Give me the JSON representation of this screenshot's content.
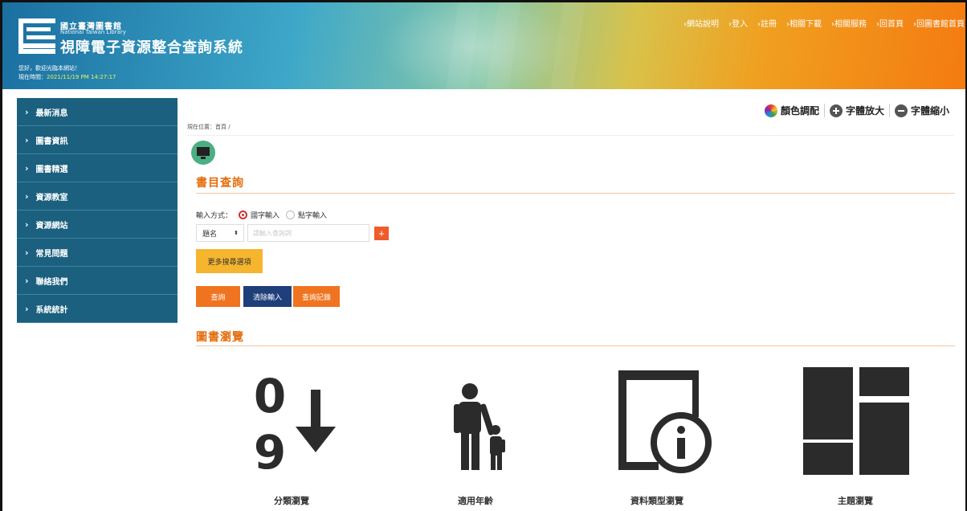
{
  "header": {
    "library_name": "國立臺灣圖書館",
    "library_english": "National Taiwan Library",
    "site_title": "視障電子資源整合查詢系統",
    "welcome": "您好，歡迎光臨本網站！",
    "time_label": "現在時間：",
    "time_value": "2021/11/19 PM 14:27:17",
    "nav": [
      "›網站說明",
      "›登入",
      "›註冊",
      "›相關下載",
      "›相關服務",
      "›回首頁",
      "›回圖書館首頁"
    ]
  },
  "sidebar": {
    "items": [
      "最新消息",
      "圖書資訊",
      "圖書精選",
      "資源教室",
      "資源網站",
      "常見問題",
      "聯絡我們",
      "系統統計"
    ]
  },
  "tools": {
    "color": "顏色調配",
    "enlarge": "字體放大",
    "shrink": "字體縮小"
  },
  "breadcrumb": "現在位置：首頁 /",
  "search": {
    "title": "書目查詢",
    "input_mode_label": "輸入方式：",
    "mode_normal": "國字輸入",
    "mode_braille": "點字輸入",
    "field": "題名",
    "placeholder": "請輸入查詢詞",
    "add_label": "+",
    "more_options": "更多搜尋選項",
    "btn_search": "查詢",
    "btn_clear": "清除輸入",
    "btn_history": "查詢記錄"
  },
  "browse": {
    "title": "圖書瀏覽",
    "items": [
      {
        "label": "分類瀏覽",
        "icon": "sort-numeric-icon"
      },
      {
        "label": "適用年齡",
        "icon": "parent-child-icon"
      },
      {
        "label": "資料類型瀏覽",
        "icon": "book-info-icon"
      },
      {
        "label": "主題瀏覽",
        "icon": "theme-grid-icon"
      }
    ]
  },
  "colors": {
    "sidebar_bg": "#1b607f",
    "accent_orange": "#f0741f",
    "button_navy": "#1f3f7a",
    "button_yellow": "#f5b52e",
    "section_title": "#e46c0a"
  }
}
